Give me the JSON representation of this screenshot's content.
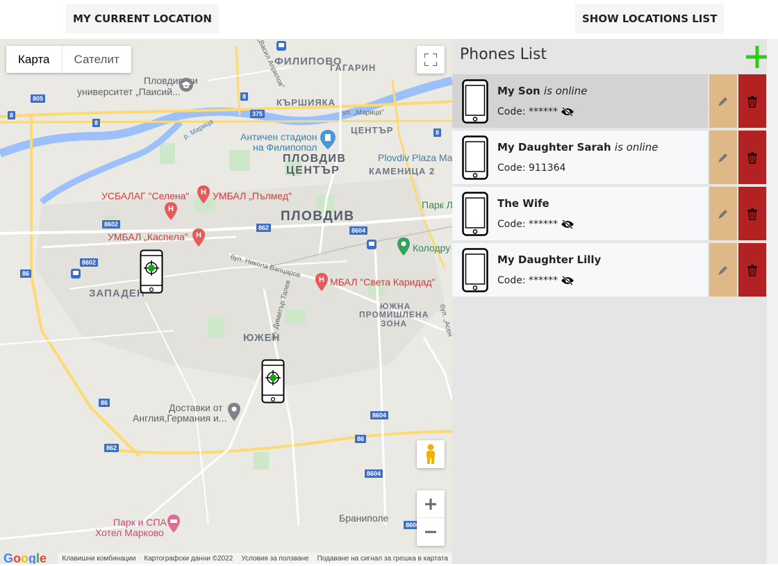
{
  "topbar": {
    "current_location_label": "MY CURRENT LOCATION",
    "show_list_label": "SHOW LOCATIONS LIST"
  },
  "map": {
    "type_map_label": "Карта",
    "type_satellite_label": "Сателит",
    "labels": {
      "filipovo": "ФИЛИПОВО",
      "gagarin": "ГАГАРИН",
      "karshiyaka": "КЪРШИЯКА",
      "tsentar": "ЦЕНТЪР",
      "plovdiv_tsentar_1": "ПЛОВДИВ",
      "plovdiv_tsentar_2": "ЦЕНТЪР",
      "kamenitsa": "КАМЕНИЦА 2",
      "plovdiv": "ПЛОВДИВ",
      "zapaden": "ЗАПАДЕН",
      "yuzhen": "ЮЖЕН",
      "yuzhna_1": "ЮЖНА",
      "yuzhna_2": "ПРОМИШЛЕНА",
      "yuzhna_3": "ЗОНА",
      "branipole": "Браниполе",
      "university_1": "Пловдивски",
      "university_2": "университет „Паисий...",
      "stadium_1": "Античен стадион",
      "stadium_2": "на Филипопол",
      "plaza": "Plovdiv Plaza Mal",
      "park_l": "Парк Л",
      "selena": "УСБАЛАГ \"Селена\"",
      "palmed": "УМБАЛ „Пълмед\"",
      "kaspela": "УМБАЛ „Каспела\"",
      "sveta_karidad": "МБАЛ \"Света Каридад\"",
      "kolodrum": "Колодру",
      "dostavki_1": "Доставки от",
      "dostavki_2": "Англия,Германия и...",
      "hotel_1": "Парк и СПА",
      "hotel_2": "Хотел Марково",
      "road_maritsa": "р. Марица",
      "road_nikola": "бул. Никола Вапцаров",
      "road_vasil": "бул. „Васил Априлов\"",
      "road_dimitar": "ул. Димитър Талев",
      "road_maritsa_st": "ул. „Марица\"",
      "road_asen": "бул. „Асен"
    },
    "shields": {
      "s805": "805",
      "s8a": "8",
      "s8b": "8",
      "s8c": "8",
      "s8d": "8",
      "s375": "375",
      "s8602a": "8602",
      "s8602b": "8602",
      "s862a": "862",
      "s862b": "862",
      "s8604a": "8604",
      "s8604b": "8604",
      "s8604c": "8604",
      "s86a": "86",
      "s86b": "86",
      "s86c": "86",
      "s8606": "8606"
    },
    "attribution": {
      "logo": "Google",
      "shortcuts": "Клавишни комбинации",
      "data": "Картографски данни ©2022",
      "terms": "Условия за ползване",
      "report": "Подаване на сигнал за грешка в картата"
    },
    "colors": {
      "road_major": "#fcd971",
      "river": "#9cc0f9",
      "park": "#c8e6c9",
      "shield": "#3d6ec5"
    }
  },
  "panel": {
    "title": "Phones List",
    "add_color": "#2ecc1a",
    "phones": [
      {
        "name": "My Son",
        "status": "is online",
        "code_label": "Code:",
        "code": "******",
        "masked": true
      },
      {
        "name": "My Daughter Sarah",
        "status": "is online",
        "code_label": "Code:",
        "code": "911364",
        "masked": false
      },
      {
        "name": "The Wife",
        "status": "",
        "code_label": "Code:",
        "code": "******",
        "masked": true
      },
      {
        "name": "My Daughter Lilly",
        "status": "",
        "code_label": "Code:",
        "code": "******",
        "masked": true
      }
    ],
    "edit_color": "#deb887",
    "delete_color": "#b22222"
  }
}
